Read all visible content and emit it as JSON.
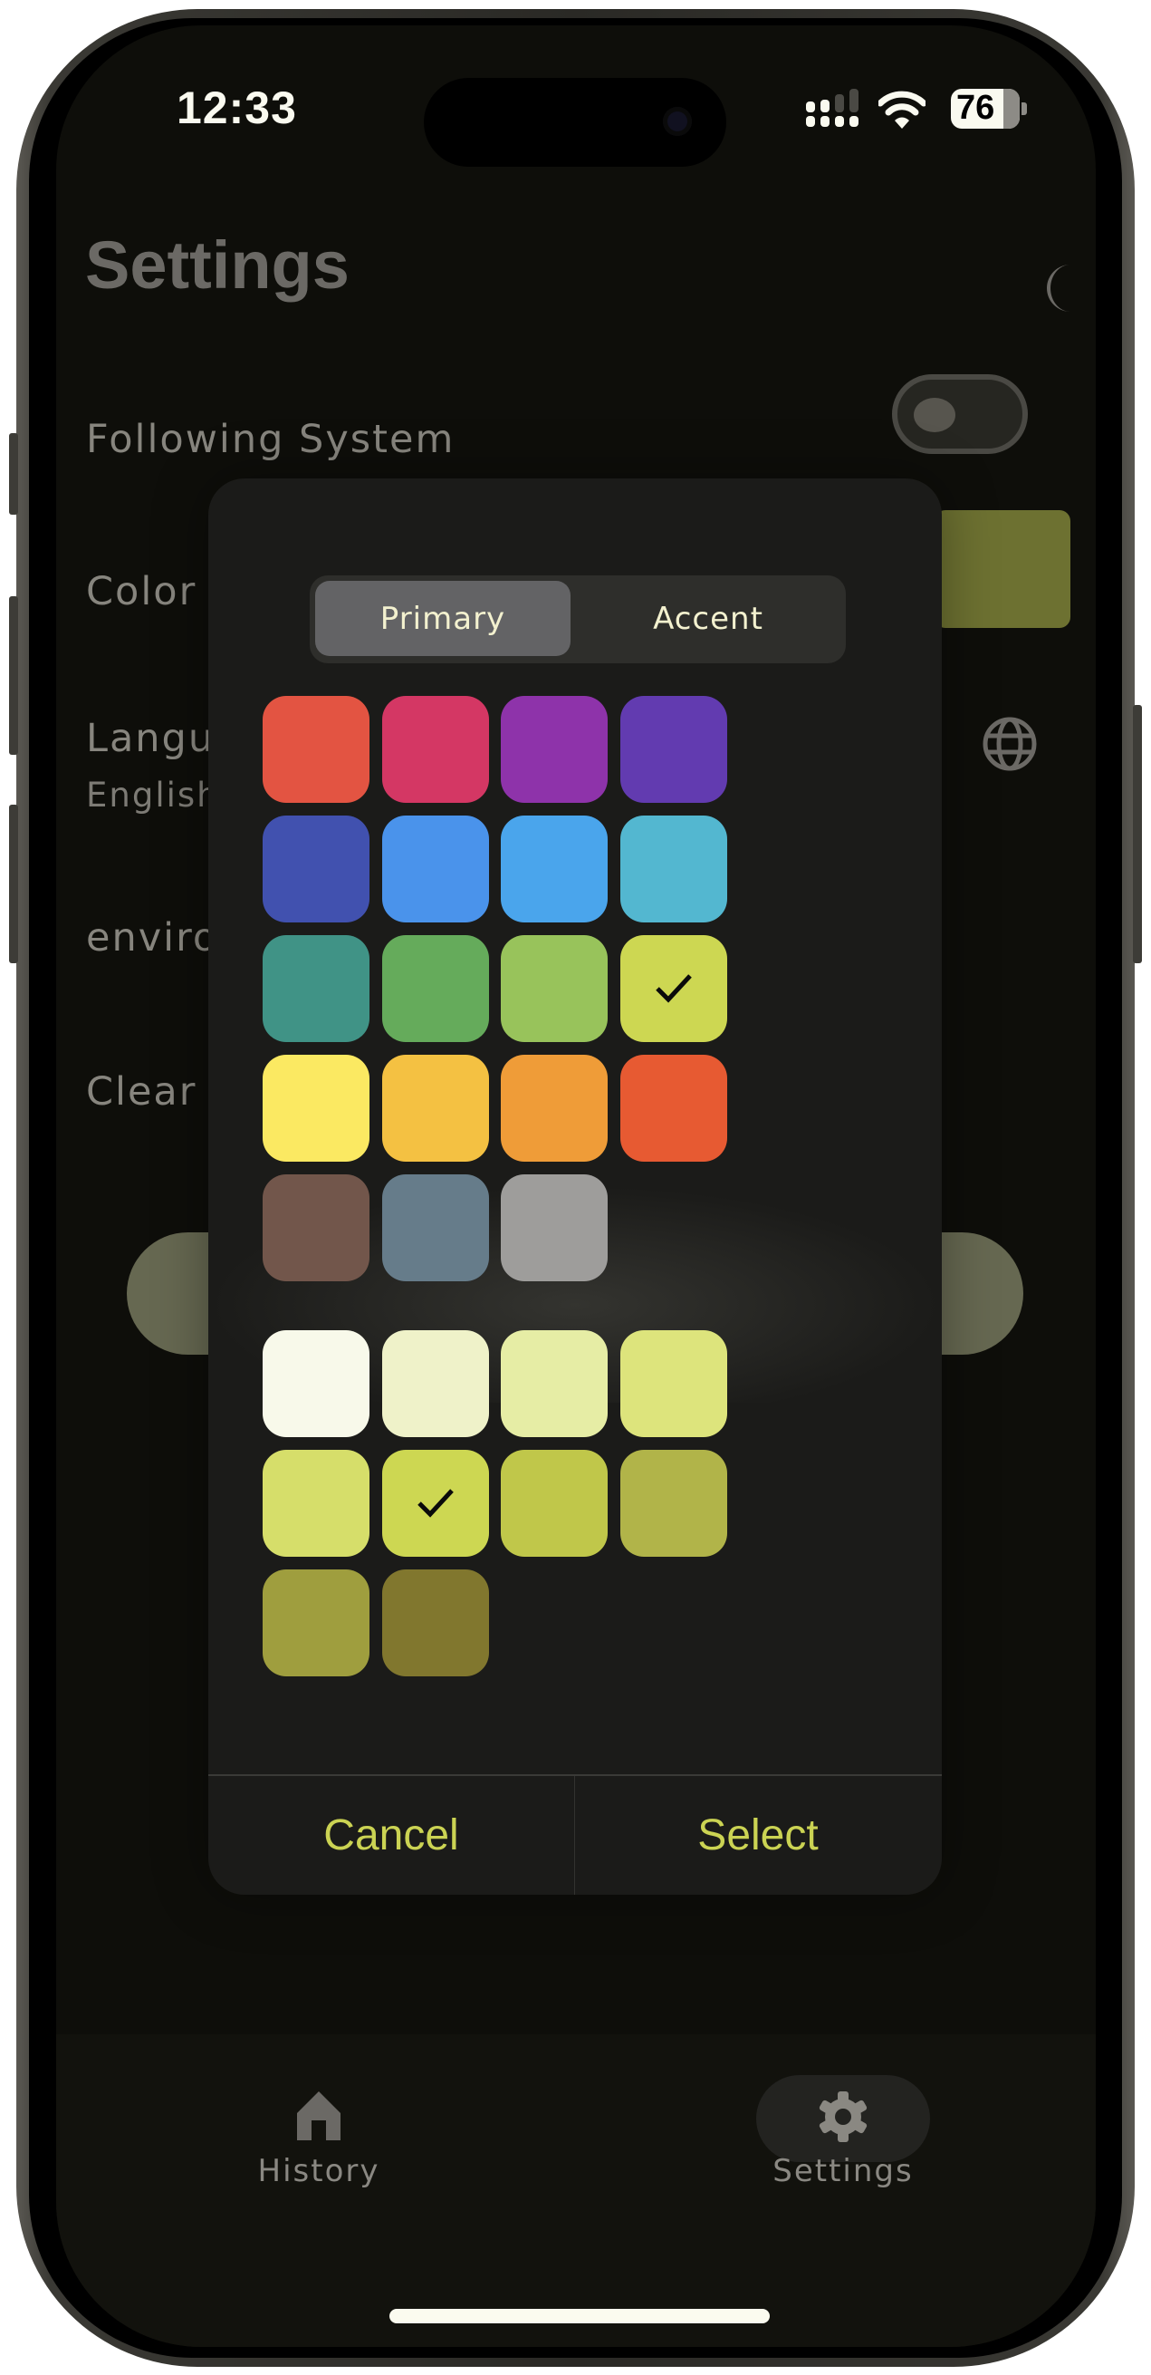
{
  "status_bar": {
    "time": "12:33",
    "battery_level": "76",
    "signal_icon": "cellular-signal-icon",
    "wifi_icon": "wifi-icon",
    "battery_icon": "battery-icon"
  },
  "header": {
    "title": "Settings",
    "theme_icon": "moon-icon"
  },
  "settings": {
    "following_system": {
      "label": "Following System",
      "toggle_on": false
    },
    "color": {
      "label": "Color",
      "current_color": "#6d7131"
    },
    "language": {
      "label": "Language",
      "value": "English",
      "icon": "globe-icon"
    },
    "environment": {
      "label": "environment"
    },
    "clear": {
      "label": "Clear"
    }
  },
  "color_dialog": {
    "tabs": [
      {
        "label": "Primary",
        "active": true
      },
      {
        "label": "Accent",
        "active": false
      }
    ],
    "primary_colors": [
      {
        "color": "#e35442",
        "selected": false
      },
      {
        "color": "#d43764",
        "selected": false
      },
      {
        "color": "#8e33aa",
        "selected": false
      },
      {
        "color": "#623bb0",
        "selected": false
      },
      {
        "color": "#4151af",
        "selected": false
      },
      {
        "color": "#4a93eb",
        "selected": false
      },
      {
        "color": "#4aa5ec",
        "selected": false
      },
      {
        "color": "#53b7d0",
        "selected": false
      },
      {
        "color": "#409386",
        "selected": false
      },
      {
        "color": "#65ab5b",
        "selected": false
      },
      {
        "color": "#98c35b",
        "selected": false
      },
      {
        "color": "#cdd752",
        "selected": true
      },
      {
        "color": "#fbe962",
        "selected": false
      },
      {
        "color": "#f4c142",
        "selected": false
      },
      {
        "color": "#ef9c38",
        "selected": false
      },
      {
        "color": "#e75a32",
        "selected": false
      },
      {
        "color": "#72564b",
        "selected": false
      },
      {
        "color": "#667c8a",
        "selected": false
      },
      {
        "color": "#9e9d9b",
        "selected": false
      }
    ],
    "shade_colors": [
      {
        "color": "#f8f9ea",
        "selected": false
      },
      {
        "color": "#eff2c9",
        "selected": false
      },
      {
        "color": "#e6eda5",
        "selected": false
      },
      {
        "color": "#dde47c",
        "selected": false
      },
      {
        "color": "#d6de6a",
        "selected": false
      },
      {
        "color": "#cdd752",
        "selected": true
      },
      {
        "color": "#c0c74a",
        "selected": false
      },
      {
        "color": "#b1b449",
        "selected": false
      },
      {
        "color": "#9f9e3e",
        "selected": false
      },
      {
        "color": "#81772e",
        "selected": false
      }
    ],
    "cancel_label": "Cancel",
    "select_label": "Select",
    "button_color": "#cbd353"
  },
  "tab_bar": {
    "items": [
      {
        "label": "History",
        "icon": "home-icon",
        "active": false
      },
      {
        "label": "Settings",
        "icon": "gear-icon",
        "active": true
      }
    ]
  }
}
